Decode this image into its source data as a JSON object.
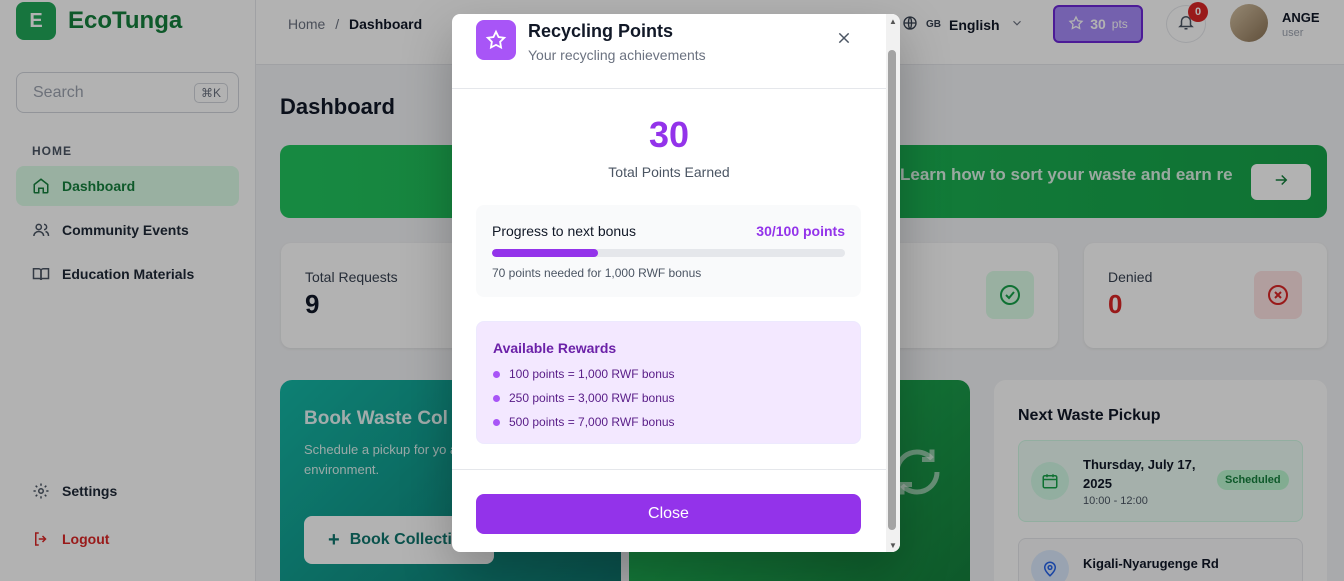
{
  "brand": {
    "logo_letter": "E",
    "name": "EcoTunga"
  },
  "search": {
    "placeholder": "Search",
    "shortcut": "⌘K"
  },
  "sidebar": {
    "section": "HOME",
    "items": [
      {
        "label": "Dashboard",
        "icon": "home-icon"
      },
      {
        "label": "Community Events",
        "icon": "users-icon"
      },
      {
        "label": "Education Materials",
        "icon": "book-icon"
      }
    ],
    "settings_label": "Settings",
    "logout_label": "Logout"
  },
  "header": {
    "breadcrumb_home": "Home",
    "breadcrumb_sep": "/",
    "breadcrumb_current": "Dashboard",
    "lang_code": "GB",
    "lang_label": "English",
    "points_value": "30",
    "points_unit": "pts",
    "notif_count": "0",
    "user_name": "ANGE",
    "user_role": "user"
  },
  "main": {
    "title": "Dashboard",
    "banner_text": "Learn how to sort your waste and earn re",
    "stats": [
      {
        "label": "Total Requests",
        "value": "9"
      },
      {
        "label": "Denied",
        "value": "0"
      }
    ],
    "book_title": "Book Waste Col",
    "book_desc": "Schedule a pickup for yo and contribute to a clea environment.",
    "book_btn": "Book Collecti",
    "pickup_title": "Next Waste Pickup",
    "pickup_date": "Thursday, July 17, 2025",
    "pickup_time": "10:00 - 12:00",
    "pickup_status": "Scheduled",
    "pickup_address": "Kigali-Nyarugenge Rd"
  },
  "modal": {
    "title": "Recycling Points",
    "subtitle": "Your recycling achievements",
    "total_points": "30",
    "total_label": "Total Points Earned",
    "progress_title": "Progress to next bonus",
    "progress_value": "30/100 points",
    "progress_fraction": 0.3,
    "progress_note": "70 points needed for 1,000 RWF bonus",
    "rewards_title": "Available Rewards",
    "rewards": [
      "100 points = 1,000 RWF bonus",
      "250 points = 3,000 RWF bonus",
      "500 points = 7,000 RWF bonus"
    ],
    "close_label": "Close"
  },
  "colors": {
    "brand_green": "#15803d",
    "accent_purple": "#9333ea",
    "danger_red": "#dc2626"
  }
}
